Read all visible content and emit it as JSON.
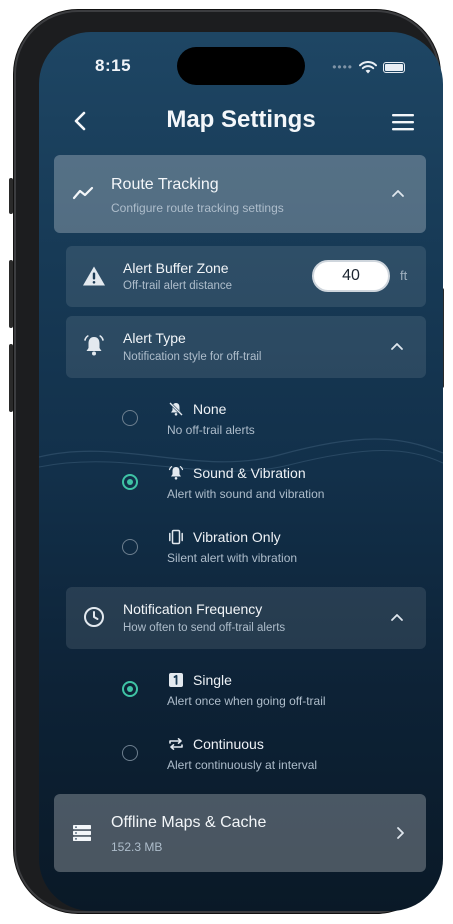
{
  "status_bar": {
    "time": "8:15"
  },
  "header": {
    "title": "Map Settings"
  },
  "route_tracking": {
    "title": "Route Tracking",
    "subtitle": "Configure route tracking settings"
  },
  "alert_buffer": {
    "title": "Alert Buffer Zone",
    "subtitle": "Off-trail alert distance",
    "value": "40",
    "unit": "ft"
  },
  "alert_type": {
    "title": "Alert Type",
    "subtitle": "Notification style for off-trail",
    "options": [
      {
        "label": "None",
        "description": "No off-trail alerts",
        "selected": false
      },
      {
        "label": "Sound & Vibration",
        "description": "Alert with sound and vibration",
        "selected": true
      },
      {
        "label": "Vibration Only",
        "description": "Silent alert with vibration",
        "selected": false
      }
    ]
  },
  "notification_frequency": {
    "title": "Notification Frequency",
    "subtitle": "How often to send off-trail alerts",
    "options": [
      {
        "label": "Single",
        "description": "Alert once when going off-trail",
        "selected": true
      },
      {
        "label": "Continuous",
        "description": "Alert continuously at interval",
        "selected": false
      }
    ]
  },
  "offline_maps": {
    "title": "Offline Maps & Cache",
    "size": "152.3 MB"
  },
  "colors": {
    "accent": "#3fc3a5",
    "background_top": "#1e4664",
    "background_bottom": "#0a1927"
  },
  "icons": {
    "back": "chevron-left-icon",
    "menu": "hamburger-menu-icon",
    "route": "trend-line-icon",
    "warning": "warning-triangle-icon",
    "bell": "bell-ring-icon",
    "clock": "clock-icon",
    "storage": "storage-icon"
  }
}
